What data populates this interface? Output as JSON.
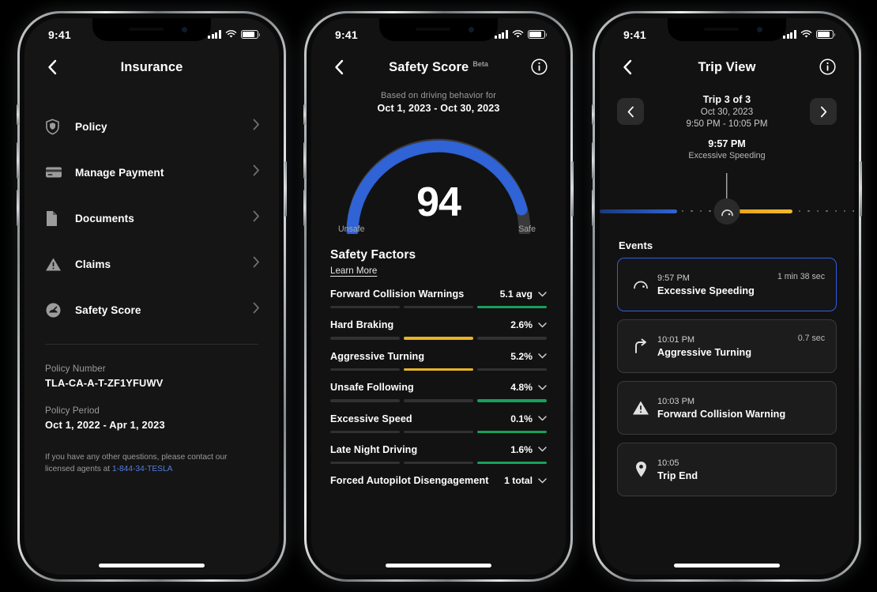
{
  "status_bar": {
    "time": "9:41",
    "signal_icon": "cellular-bars-icon",
    "wifi_icon": "wifi-icon",
    "battery_icon": "battery-icon"
  },
  "colors": {
    "accent_blue": "#2f63d6",
    "selected_border": "#2f5fe0",
    "green": "#17a05a",
    "amber": "#e8b427",
    "link": "#4f7fe0",
    "screen_bg": "#151515"
  },
  "phone1": {
    "nav": {
      "title": "Insurance",
      "back_icon": "chevron-left-icon"
    },
    "menu": [
      {
        "label": "Policy",
        "icon": "shield-icon",
        "chevron": "chevron-right-icon"
      },
      {
        "label": "Manage Payment",
        "icon": "credit-card-icon",
        "chevron": "chevron-right-icon"
      },
      {
        "label": "Documents",
        "icon": "document-icon",
        "chevron": "chevron-right-icon"
      },
      {
        "label": "Claims",
        "icon": "warning-triangle-icon",
        "chevron": "chevron-right-icon"
      },
      {
        "label": "Safety Score",
        "icon": "speedometer-icon",
        "chevron": "chevron-right-icon"
      }
    ],
    "policy": {
      "number_label": "Policy Number",
      "number_value": "TLA-CA-A-T-ZF1YFUWV",
      "period_label": "Policy Period",
      "period_value": "Oct 1, 2022 - Apr 1, 2023"
    },
    "footer": {
      "text": "If you have any other questions, please contact our licensed agents at ",
      "phone": "1-844-34-TESLA"
    }
  },
  "phone2": {
    "nav": {
      "title": "Safety Score",
      "badge": "Beta",
      "back_icon": "chevron-left-icon",
      "info_icon": "info-circle-icon"
    },
    "subtitle": {
      "line1": "Based on driving behavior for",
      "line2": "Oct 1, 2023 - Oct 30, 2023"
    },
    "gauge": {
      "score": "94",
      "left_label": "Unsafe",
      "right_label": "Safe"
    },
    "factors_header": {
      "title": "Safety Factors",
      "learn_more": "Learn More"
    },
    "chart_data": {
      "type": "bar",
      "title": "Safety Factors",
      "categories": [
        "Forward Collision Warnings",
        "Hard Braking",
        "Aggressive Turning",
        "Unsafe Following",
        "Excessive Speed",
        "Late Night Driving",
        "Forced Autopilot Disengagement"
      ],
      "values": [
        5.1,
        2.6,
        5.2,
        4.8,
        0.1,
        1.6,
        1
      ],
      "value_labels": [
        "5.1 avg",
        "2.6%",
        "5.2%",
        "4.8%",
        "0.1%",
        "1.6%",
        "1 total"
      ],
      "segment_states": [
        [
          "dim",
          "dim",
          "green"
        ],
        [
          "dim",
          "amber",
          "dim"
        ],
        [
          "dim",
          "amber",
          "dim"
        ],
        [
          "dim",
          "dim",
          "green"
        ],
        [
          "dim",
          "dim",
          "green"
        ],
        [
          "dim",
          "dim",
          "green"
        ],
        [
          "dim",
          "dim",
          "dim"
        ]
      ],
      "gauge_score": 94,
      "gauge_range": [
        0,
        100
      ],
      "ylabel": "",
      "xlabel": ""
    },
    "factors": [
      {
        "name": "Forward Collision Warnings",
        "value": "5.1 avg",
        "chevron": "chevron-down-icon"
      },
      {
        "name": "Hard Braking",
        "value": "2.6%",
        "chevron": "chevron-down-icon"
      },
      {
        "name": "Aggressive Turning",
        "value": "5.2%",
        "chevron": "chevron-down-icon"
      },
      {
        "name": "Unsafe Following",
        "value": "4.8%",
        "chevron": "chevron-down-icon"
      },
      {
        "name": "Excessive Speed",
        "value": "0.1%",
        "chevron": "chevron-down-icon"
      },
      {
        "name": "Late Night Driving",
        "value": "1.6%",
        "chevron": "chevron-down-icon"
      },
      {
        "name": "Forced Autopilot Disengagement",
        "value": "1 total",
        "chevron": "chevron-down-icon"
      }
    ]
  },
  "phone3": {
    "nav": {
      "title": "Trip View",
      "back_icon": "chevron-left-icon",
      "info_icon": "info-circle-icon"
    },
    "trip": {
      "counter": "Trip 3 of 3",
      "date": "Oct 30, 2023",
      "time_range": "9:50 PM - 10:05 PM",
      "prev_icon": "chevron-left-icon",
      "next_icon": "chevron-right-icon"
    },
    "scrubber": {
      "time": "9:57 PM",
      "label": "Excessive Speeding",
      "handle_icon": "speedometer-icon"
    },
    "events_title": "Events",
    "events": [
      {
        "time": "9:57 PM",
        "name": "Excessive Speeding",
        "duration": "1 min 38 sec",
        "icon": "speedometer-icon",
        "selected": true
      },
      {
        "time": "10:01 PM",
        "name": "Aggressive Turning",
        "duration": "0.7 sec",
        "icon": "turn-arrow-icon",
        "selected": false
      },
      {
        "time": "10:03 PM",
        "name": "Forward Collision Warning",
        "duration": "",
        "icon": "warning-triangle-icon",
        "selected": false
      },
      {
        "time": "10:05",
        "name": "Trip End",
        "duration": "",
        "icon": "map-pin-icon",
        "selected": false
      }
    ]
  }
}
